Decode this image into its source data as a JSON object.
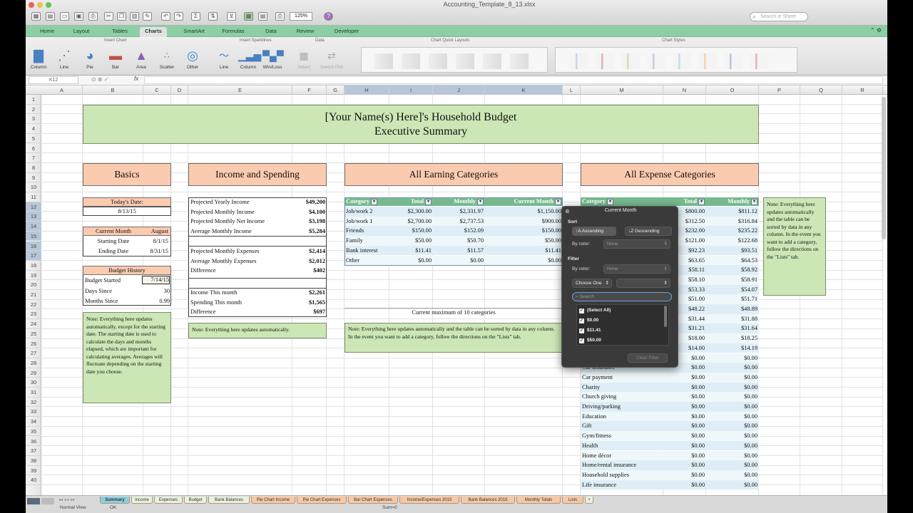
{
  "window": {
    "doc_title": "Accounting_Template_8_13.xlsx",
    "search_placeholder": "Search in Sheet",
    "zoom": "125%"
  },
  "ribbon": {
    "tabs": [
      "Home",
      "Layout",
      "Tables",
      "Charts",
      "SmartArt",
      "Formulas",
      "Data",
      "Review",
      "Developer"
    ],
    "active_tab": "Charts",
    "groups": {
      "insert_chart": "Insert Chart",
      "insert_sparklines": "Insert Sparklines",
      "data": "Data",
      "quick_layouts": "Chart Quick Layouts",
      "styles": "Chart Styles"
    },
    "buttons": {
      "column": "Column",
      "line": "Line",
      "pie": "Pie",
      "bar": "Bar",
      "area": "Area",
      "scatter": "Scatter",
      "other": "Other",
      "spark_line": "Line",
      "spark_column": "Column",
      "spark_winloss": "Win/Loss",
      "select": "Select",
      "switch_plot": "Switch Plot"
    }
  },
  "formula_bar": {
    "cell_ref": "K12",
    "fx": "fx"
  },
  "columns": [
    "A",
    "B",
    "C",
    "D",
    "E",
    "F",
    "G",
    "H",
    "I",
    "J",
    "K",
    "L",
    "M",
    "N",
    "O",
    "P",
    "Q",
    "R"
  ],
  "rows": [
    "1",
    "2",
    "3",
    "4",
    "5",
    "6",
    "7",
    "8",
    "9",
    "10",
    "11",
    "12",
    "13",
    "14",
    "15",
    "16",
    "17",
    "18",
    "19",
    "20",
    "21",
    "22",
    "23",
    "24",
    "25",
    "26",
    "27",
    "28",
    "29",
    "30",
    "31",
    "32",
    "33",
    "34",
    "35",
    "36",
    "37",
    "38",
    "39",
    "40"
  ],
  "sheet": {
    "title_line1": "[Your Name(s) Here]'s Household Budget",
    "title_line2": "Executive Summary",
    "basics": {
      "header": "Basics",
      "todays_date_label": "Today's Date:",
      "todays_date": "8/13/15",
      "current_month_label": "Current Month",
      "current_month": "August",
      "starting_date_label": "Starting Date",
      "starting_date": "8/1/15",
      "ending_date_label": "Ending Date",
      "ending_date": "8/31/15",
      "budget_history_label": "Budget History",
      "budget_started_label": "Budget Started",
      "budget_started": "7/14/15",
      "days_since_label": "Days Since",
      "days_since": "30",
      "months_since_label": "Months Since",
      "months_since": "0.99",
      "note": "Note: Everything here updates automatically, except for the starting date. The starting date is used to calculate the days and months elapsed, which are important for calculating averages. Averages will fluctuate depending on the starting date you choose."
    },
    "income_spending": {
      "header": "Income and Spending",
      "rows": [
        {
          "label": "Projected Yearly Income",
          "value": "$49,200"
        },
        {
          "label": "Projected Monthly Income",
          "value": "$4,100"
        },
        {
          "label": "Projected Monthly Net Income",
          "value": "$3,198"
        },
        {
          "label": "Average Monthly Income",
          "value": "$5,284"
        },
        {
          "label": "Projected Monthly Expenses",
          "value": "$2,414"
        },
        {
          "label": "Average Monthly Expenses",
          "value": "$2,012"
        },
        {
          "label": "Difference",
          "value": "$402"
        },
        {
          "label": "Income This month",
          "value": "$2,261"
        },
        {
          "label": "Spending This month",
          "value": "$1,565"
        },
        {
          "label": "Difference",
          "value": "$697"
        }
      ],
      "note": "Note: Everything here updates automatically."
    },
    "earning": {
      "header": "All Earning Categories",
      "columns": [
        "Category",
        "Total",
        "Monthly",
        "Current Month"
      ],
      "rows": [
        [
          "Job/work 2",
          "$2,300.00",
          "$2,331.97",
          "$1,150.00"
        ],
        [
          "Job/work 1",
          "$2,700.00",
          "$2,737.53",
          "$900.00"
        ],
        [
          "Friends",
          "$150.00",
          "$152.09",
          "$150.00"
        ],
        [
          "Family",
          "$50.00",
          "$50.70",
          "$50.00"
        ],
        [
          "Bank interest",
          "$11.41",
          "$11.57",
          "$11.41"
        ],
        [
          "Other",
          "$0.00",
          "$0.00",
          "$0.00"
        ]
      ],
      "max_note": "Current maximum of 10 categories",
      "note": "Note: Everything here updates automatically and the table can be sorted by data in any column. In the event you want to add a category, follow the directions on the \"Lists\" tab."
    },
    "expense": {
      "header": "All Expense Categories",
      "columns": [
        "Category",
        "Total",
        "Monthly"
      ],
      "visible_rows": [
        [
          "",
          "$800.00",
          "$811.12"
        ],
        [
          "",
          "$312.50",
          "$316.84"
        ],
        [
          "",
          "$232.00",
          "$235.22"
        ],
        [
          "",
          "$121.00",
          "$122.68"
        ],
        [
          "",
          "$92.23",
          "$93.51"
        ],
        [
          "",
          "$63.65",
          "$64.53"
        ],
        [
          "",
          "$58.11",
          "$58.92"
        ],
        [
          "",
          "$58.10",
          "$58.91"
        ],
        [
          "",
          "$53.33",
          "$54.07"
        ],
        [
          "",
          "$51.00",
          "$51.71"
        ],
        [
          "",
          "$48.22",
          "$48.89"
        ],
        [
          "",
          "$31.44",
          "$31.88"
        ],
        [
          "",
          "$31.21",
          "$31.64"
        ],
        [
          "",
          "$18.00",
          "$18.25"
        ],
        [
          "",
          "$14.00",
          "$14.19"
        ],
        [
          "",
          "$0.00",
          "$0.00"
        ],
        [
          "Car insurance",
          "$0.00",
          "$0.00"
        ],
        [
          "Car payment",
          "$0.00",
          "$0.00"
        ],
        [
          "Charity",
          "$0.00",
          "$0.00"
        ],
        [
          "Church giving",
          "$0.00",
          "$0.00"
        ],
        [
          "Driving/parking",
          "$0.00",
          "$0.00"
        ],
        [
          "Education",
          "$0.00",
          "$0.00"
        ],
        [
          "Gift",
          "$0.00",
          "$0.00"
        ],
        [
          "Gym/fitness",
          "$0.00",
          "$0.00"
        ],
        [
          "Health",
          "$0.00",
          "$0.00"
        ],
        [
          "Home décor",
          "$0.00",
          "$0.00"
        ],
        [
          "Home/rental insurance",
          "$0.00",
          "$0.00"
        ],
        [
          "Household supplies",
          "$0.00",
          "$0.00"
        ],
        [
          "Life insurance",
          "$0.00",
          "$0.00"
        ]
      ],
      "note": "Note: Everything here updates automatically and the table can be sorted by data in any column. In the event you want to add a category, follow the directions on the \"Lists\" tab."
    }
  },
  "filter_popup": {
    "title": "Current Month",
    "sort_label": "Sort",
    "ascending": "Ascending",
    "descending": "Descending",
    "by_color_label": "By color:",
    "none": "None",
    "filter_label": "Filter",
    "choose_one": "Choose One",
    "search_placeholder": "Search",
    "items": [
      "(Select All)",
      "$0.00",
      "$11.41",
      "$50.00"
    ],
    "clear_filter": "Clear Filter"
  },
  "sheet_tabs": [
    "Summary",
    "Income",
    "Expenses",
    "Budget",
    "Bank Balances",
    "Pie Chart Income",
    "Pie Chart Expenses",
    "Bar Chart Expenses",
    "Income/Expenses 2015",
    "Bank Balances 2015",
    "Monthly Totals",
    "Lists"
  ],
  "active_sheet": "Summary",
  "status_bar": {
    "view": "Normal View",
    "mode": "OK",
    "sum": "Sum=0"
  }
}
